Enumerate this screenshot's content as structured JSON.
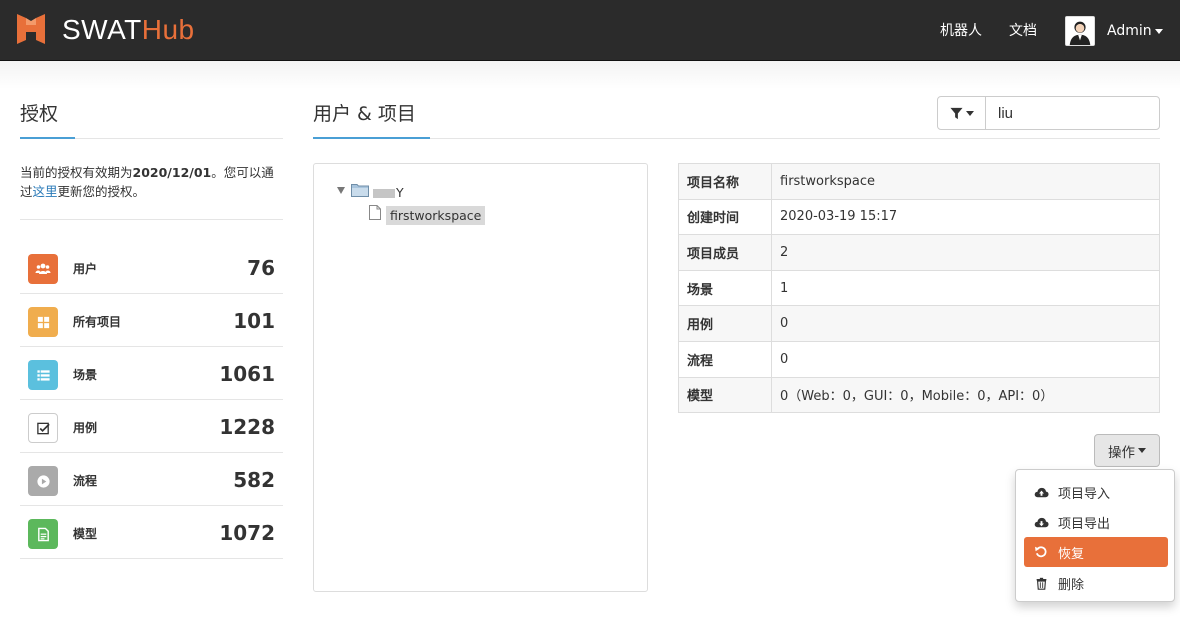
{
  "header": {
    "brand_primary": "SWAT",
    "brand_accent": "Hub",
    "nav_robot": "机器人",
    "nav_docs": "文档",
    "user_name": "Admin"
  },
  "license": {
    "title": "授权",
    "text_before": "当前的授权有效期为",
    "expiry": "2020/12/01",
    "text_middle": "。您可以通过",
    "link": "这里",
    "text_after": "更新您的授权。"
  },
  "stats": [
    {
      "label": "用户",
      "value": "76",
      "icon": "users-icon",
      "color": "#e8703a"
    },
    {
      "label": "所有项目",
      "value": "101",
      "icon": "grid-icon",
      "color": "#f0ad4e"
    },
    {
      "label": "场景",
      "value": "1061",
      "icon": "list-icon",
      "color": "#5bc0de"
    },
    {
      "label": "用例",
      "value": "1228",
      "icon": "checkbox-icon",
      "color": "#ffffff"
    },
    {
      "label": "流程",
      "value": "582",
      "icon": "play-icon",
      "color": "#aaaaaa"
    },
    {
      "label": "模型",
      "value": "1072",
      "icon": "document-icon",
      "color": "#5cb85c"
    }
  ],
  "main": {
    "title": "用户 & 项目",
    "filter_value": "liu"
  },
  "tree": {
    "root_label": "Y",
    "child_label": "firstworkspace"
  },
  "project_info": [
    {
      "key": "项目名称",
      "value": "firstworkspace"
    },
    {
      "key": "创建时间",
      "value": "2020-03-19 15:17"
    },
    {
      "key": "项目成员",
      "value": "2"
    },
    {
      "key": "场景",
      "value": "1"
    },
    {
      "key": "用例",
      "value": "0"
    },
    {
      "key": "流程",
      "value": "0"
    },
    {
      "key": "模型",
      "value": "0（Web：0，GUI：0，Mobile：0，API：0）"
    }
  ],
  "actions": {
    "button_label": "操作",
    "menu": [
      {
        "label": "项目导入",
        "icon": "cloud-upload-icon"
      },
      {
        "label": "项目导出",
        "icon": "cloud-download-icon"
      },
      {
        "label": "恢复",
        "icon": "restore-icon",
        "active": true
      },
      {
        "label": "删除",
        "icon": "trash-icon"
      }
    ]
  },
  "colors": {
    "accent": "#e8703a",
    "navbar": "#2b2b2b",
    "link": "#2a7ab8"
  }
}
